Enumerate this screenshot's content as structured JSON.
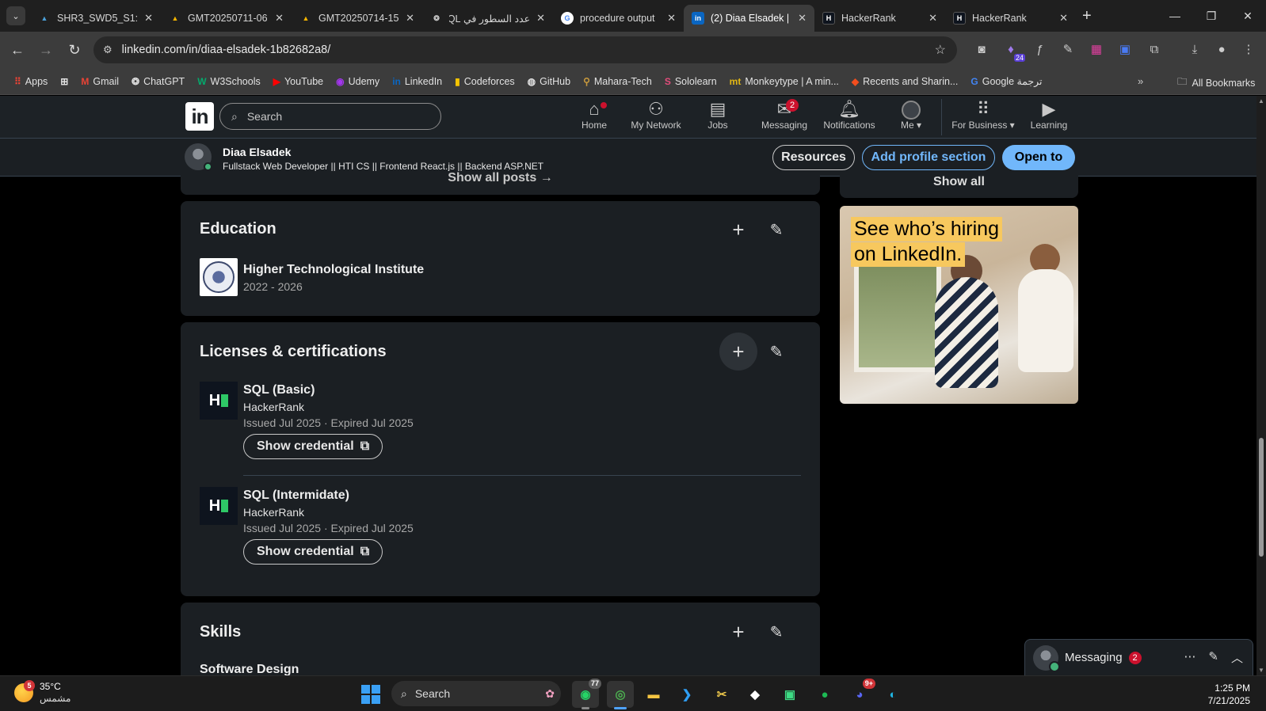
{
  "browser": {
    "tabs": [
      {
        "title": "SHR3_SWD5_S1: S",
        "favicon": "azure-icon",
        "color": "#4a9fd8"
      },
      {
        "title": "GMT20250711-06",
        "favicon": "google-drive-icon",
        "color": "#f4b400"
      },
      {
        "title": "GMT20250714-15",
        "favicon": "google-drive-icon",
        "color": "#f4b400"
      },
      {
        "title": "عدد السطور في SQL",
        "favicon": "chatgpt-icon",
        "color": "#cccccc"
      },
      {
        "title": "procedure output",
        "favicon": "google-icon",
        "color": "#ffffff"
      },
      {
        "title": "(2) Diaa Elsadek | L",
        "favicon": "linkedin-icon",
        "color": "#0a66c2"
      },
      {
        "title": "HackerRank",
        "favicon": "hackerrank-icon",
        "color": "#0e141e"
      },
      {
        "title": "HackerRank",
        "favicon": "hackerrank-icon",
        "color": "#0e141e"
      }
    ],
    "url": "linkedin.com/in/diaa-elsadek-1b82682a8/",
    "extension_badge": "24",
    "bookmarks": [
      "Apps",
      "Gmail",
      "ChatGPT",
      "W3Schools",
      "YouTube",
      "Udemy",
      "LinkedIn",
      "Codeforces",
      "GitHub",
      "Mahara-Tech",
      "Sololearn",
      "Monkeytype | A min...",
      "Recents and Sharin...",
      "Google ترجمة"
    ],
    "all_bookmarks": "All Bookmarks"
  },
  "linkedin": {
    "logo": "in",
    "search_placeholder": "Search",
    "nav": [
      {
        "label": "Home",
        "icon": "home-icon"
      },
      {
        "label": "My Network",
        "icon": "network-icon"
      },
      {
        "label": "Jobs",
        "icon": "briefcase-icon"
      },
      {
        "label": "Messaging",
        "icon": "messaging-icon",
        "badge": "2"
      },
      {
        "label": "Notifications",
        "icon": "bell-icon"
      },
      {
        "label": "Me ▾",
        "icon": "avatar-icon"
      },
      {
        "label": "For Business ▾",
        "icon": "grid-icon"
      },
      {
        "label": "Learning",
        "icon": "learning-icon"
      }
    ],
    "profile": {
      "name": "Diaa Elsadek",
      "headline": "Fullstack Web Developer || HTI CS || Frontend React.js || Backend ASP.NET"
    },
    "actions": {
      "resources": "Resources",
      "add_section": "Add profile section",
      "open_to": "Open to"
    },
    "show_all_posts": "Show all posts →",
    "show_all": "Show all",
    "education": {
      "heading": "Education",
      "items": [
        {
          "school": "Higher Technological Institute",
          "years": "2022 - 2026"
        }
      ]
    },
    "licenses": {
      "heading": "Licenses & certifications",
      "items": [
        {
          "name": "SQL (Basic)",
          "issuer": "HackerRank",
          "dates": "Issued Jul 2025 · Expired Jul 2025",
          "button": "Show credential"
        },
        {
          "name": "SQL (Intermidate)",
          "issuer": "HackerRank",
          "dates": "Issued Jul 2025 · Expired Jul 2025",
          "button": "Show credential"
        }
      ]
    },
    "skills": {
      "heading": "Skills",
      "first": "Software Design"
    },
    "ad": {
      "line1": "See who’s hiring",
      "line2": "on LinkedIn."
    },
    "messaging_dock": {
      "label": "Messaging",
      "count": "2"
    }
  },
  "taskbar": {
    "weather": {
      "temp": "35°C",
      "condition": "مشمس",
      "badge": "5"
    },
    "search_label": "Search",
    "whatsapp_badge": "77",
    "discord_badge": "9+",
    "time": "1:25 PM",
    "date": "7/21/2025"
  }
}
